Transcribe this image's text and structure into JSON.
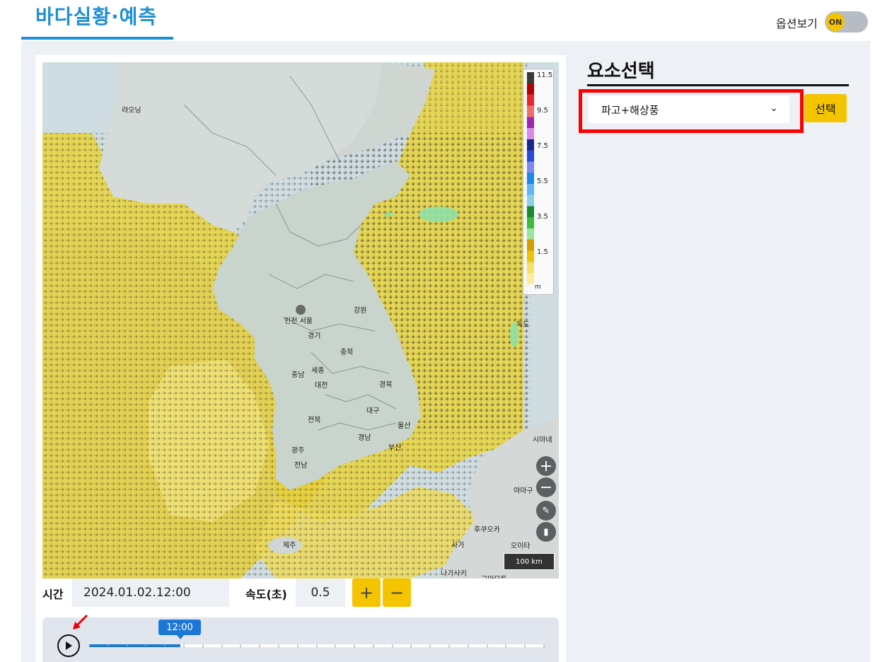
{
  "header": {
    "title": "바다실황·예측",
    "options_label": "옵션보기",
    "options_toggle": "ON"
  },
  "map": {
    "place_labels": {
      "liaoning": "랴오닝",
      "gangwon": "강원",
      "gyeonggi": "경기",
      "incheon_seoul": "인천 서울",
      "chungbuk": "충북",
      "chungnam": "충남",
      "sejong": "세종",
      "daejeon": "대전",
      "gyeongbuk": "경북",
      "daegu": "대구",
      "jeonbuk": "전북",
      "ulsan": "울산",
      "gyeongnam": "경남",
      "busan": "부산",
      "gwangju": "광주",
      "jeonnam": "전남",
      "jeju": "제주",
      "dokdo": "독도",
      "shimane": "시마네",
      "yamaguchi": "야마구",
      "fukuoka": "후쿠오카",
      "saga": "사가",
      "oita": "오이타",
      "nagasaki": "나가사키",
      "kumamoto": "구마모토"
    },
    "legend": {
      "unit": "m",
      "labels": [
        "11.5",
        "9.5",
        "7.5",
        "5.5",
        "3.5",
        "1.5"
      ],
      "colors": [
        "#3a3a3a",
        "#b30000",
        "#e8262b",
        "#f26d6d",
        "#9c27b0",
        "#d98be8",
        "#1a2a8c",
        "#2a4bd6",
        "#7b8dea",
        "#1e88e5",
        "#64b5f6",
        "#8fd0e8",
        "#1b8a2a",
        "#3cbb3c",
        "#9be39b",
        "#d4a000",
        "#ecc20a",
        "#f7df6a",
        "#fbee9e"
      ]
    },
    "scale": "100 km",
    "zoom_in": "+",
    "zoom_out": "−",
    "accent_color": "#e8d24a"
  },
  "controls": {
    "time_label": "시간",
    "time_value": "2024.01.02.12:00",
    "speed_label": "속도(초)",
    "speed_value": "0.5",
    "plus": "+",
    "minus": "−"
  },
  "timeline": {
    "current_time": "12:00",
    "progress": 0.2
  },
  "sidebar": {
    "title": "요소선택",
    "selected_option": "파고+해상풍",
    "select_button": "선택"
  }
}
